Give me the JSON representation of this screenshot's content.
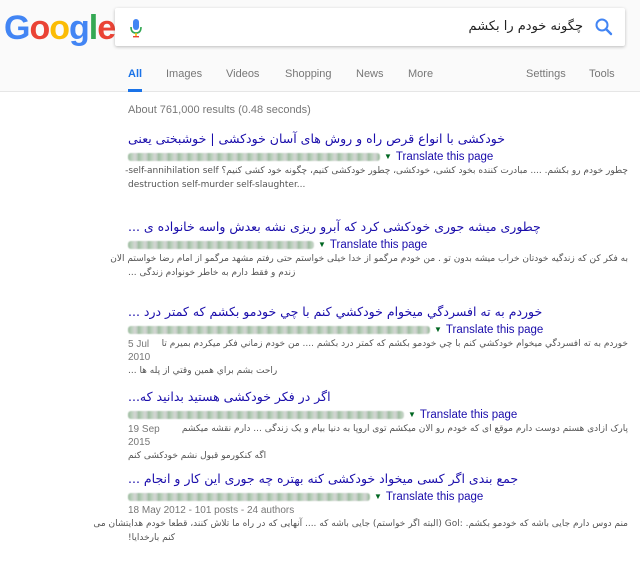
{
  "logo": {
    "letters": [
      "G",
      "o",
      "o",
      "g",
      "l",
      "e"
    ],
    "colors": [
      "#4285f4",
      "#ea4335",
      "#fbbc05",
      "#4285f4",
      "#34a853",
      "#ea4335"
    ]
  },
  "search": {
    "query": "چگونه خودم را بکشم"
  },
  "tabs": {
    "all": "All",
    "images": "Images",
    "videos": "Videos",
    "shopping": "Shopping",
    "news": "News",
    "more": "More",
    "settings": "Settings",
    "tools": "Tools"
  },
  "stats": "About 761,000 results (0.48 seconds)",
  "translate_label": "Translate this page",
  "results": [
    {
      "title": "خودکشی با انواع قرص راه و روش های آسان خودکشی | خوشبختی یعنی",
      "snippet1": "چطور خودم رو بکشم. .... مبادرت کننده بخود کشی، خودکشی، چطور خودکشی کنیم، چگونه خود کشی کنیم؟ self-annihilation self-",
      "snippet2": "destruction self-murder self-slaughter..."
    },
    {
      "title": "چطوری میشه جوری خودکشی کرد که آبرو ریزی نشه بعدش واسه خانواده ی ...",
      "snippet1": "به فکر کن که زندگیه خودتان خراب میشه بدون تو . من خودم مرگمو از خدا خیلی خواستم حتی رفتم مشهد مرگمو از امام رضا خواستم الان",
      "snippet2": "زندم و فقط دارم به خاطر خونوادم زندگی ..."
    },
    {
      "title": "خوردم به ته افسردگي ميخوام خودکشي کنم با چي خودمو بکشم که کمتر درد ...",
      "date": "5 Jul 2010",
      "snippet1": "خوردم به ته افسردگي ميخوام خودکشي کنم با چي خودمو بکشم که کمتر درد بکشم .... من خودم زماني فکر ميکردم بميرم تا",
      "snippet2": "راحت بشم براي همين وقتي از پله ها ..."
    },
    {
      "title": "اگر در فکر خودکشی هستید بدانید که...",
      "date": "19 Sep 2015",
      "snippet1": "پارک ازادی هستم دوست دارم موقع ای که خودم رو الان میکشم توی اروپا به دنیا بیام و یک زندگی ... دارم نقشه میکشم",
      "snippet2": "اگه کنکورمو قبول نشم خودکشی کنم"
    },
    {
      "title": "جمع بندی اگر کسی میخواد خودکشی کنه بهتره چه جوری این کار و انجام ...",
      "meta": "18 May 2012 - 101 posts - 24 authors",
      "snippet1": "منم دوس دارم جایی باشه که خودمو بکشم. :Gol (البته اگر خواستم) جایی باشه که .... آنهایی که در راه ما تلاش کنند، قطعا خودم هدایتشان می",
      "snippet2": "کنم بارخدایا!"
    }
  ]
}
